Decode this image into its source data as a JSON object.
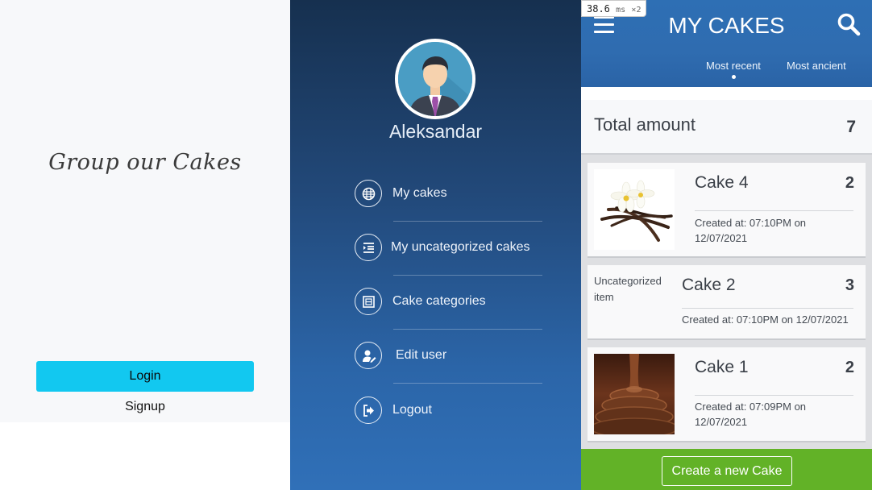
{
  "login_screen": {
    "brand": "Group our Cakes",
    "login_label": "Login",
    "signup_label": "Signup",
    "colors": {
      "login_button": "#12c8f0",
      "background": "#f7f8fa"
    }
  },
  "side_menu": {
    "username": "Aleksandar",
    "items": [
      {
        "label": "My cakes",
        "icon": "cake-icon"
      },
      {
        "label": "My uncategorized cakes",
        "icon": "list-indent-icon"
      },
      {
        "label": "Cake categories",
        "icon": "category-box-icon"
      },
      {
        "label": "Edit user",
        "icon": "user-edit-icon"
      },
      {
        "label": "Logout",
        "icon": "logout-icon"
      }
    ],
    "colors": {
      "gradient_top": "#16304f",
      "gradient_bottom": "#3070b8"
    }
  },
  "cakes_screen": {
    "timer": {
      "value": "38.6",
      "unit": "ms",
      "multiplier": "×2"
    },
    "title": "MY CAKES",
    "tabs": [
      {
        "label": "Most recent",
        "active": true
      },
      {
        "label": "Most ancient",
        "active": false
      }
    ],
    "total": {
      "label": "Total amount",
      "value": "7"
    },
    "cakes": [
      {
        "name": "Cake 4",
        "count": "2",
        "date_line1": "Created at: 07:10PM on",
        "date_line2": "12/07/2021",
        "image": "vanilla-flower-image"
      },
      {
        "name": "Cake 2",
        "count": "3",
        "date": "Created at: 07:10PM on 12/07/2021",
        "badge": "Uncategorized item"
      },
      {
        "name": "Cake 1",
        "count": "2",
        "date_line1": "Created at: 07:09PM on",
        "date_line2": "12/07/2021",
        "image": "chocolate-swirl-image"
      }
    ],
    "create_label": "Create a new Cake",
    "colors": {
      "appbar": "#2e6fb4",
      "bottom_bar": "#62b227"
    }
  }
}
